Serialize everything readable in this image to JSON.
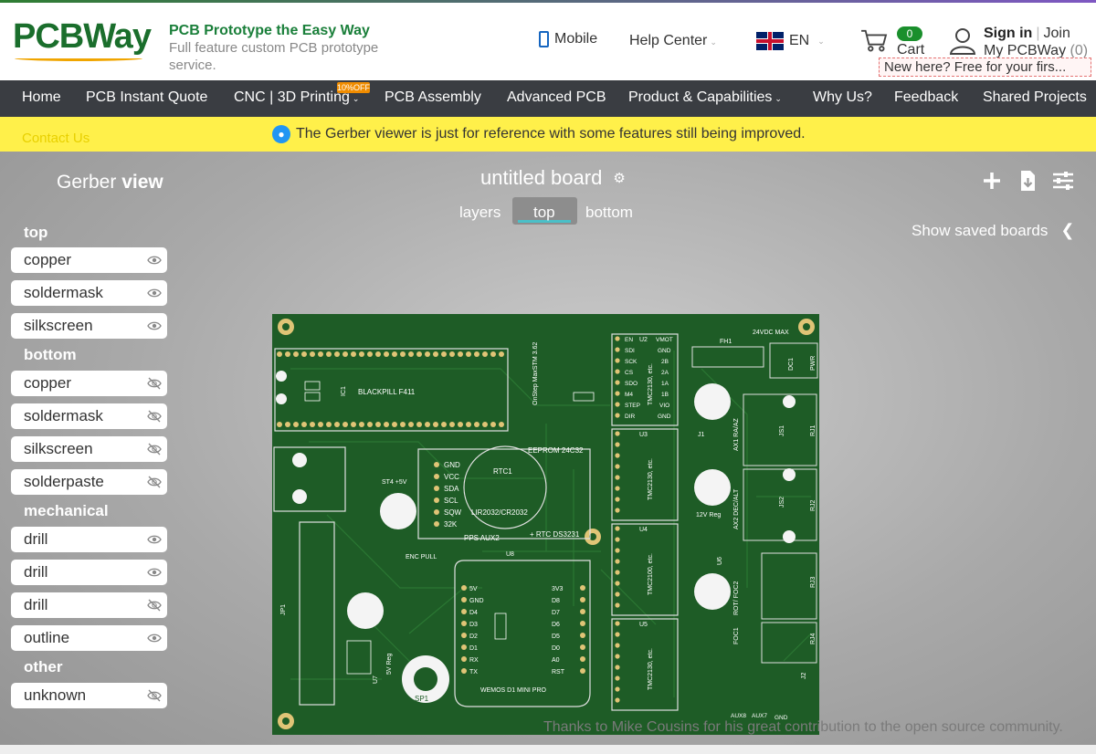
{
  "header": {
    "logo": "PCBWay",
    "tagline_title": "PCB Prototype the Easy Way",
    "tagline_sub": "Full feature custom PCB prototype service.",
    "mobile": "Mobile",
    "help_center": "Help Center",
    "language": "EN",
    "cart_count": "0",
    "cart_label": "Cart",
    "sign_in": "Sign in",
    "join": "Join",
    "my_pcbway": "My PCBWay",
    "my_pcbway_count": "(0)",
    "new_here": "New here? Free for your firs..."
  },
  "nav": {
    "items": [
      "Home",
      "PCB Instant Quote",
      "CNC | 3D Printing",
      "PCB Assembly",
      "Advanced PCB",
      "Product & Capabilities",
      "Why Us?",
      "Feedback",
      "Shared Projects"
    ],
    "badge": "10%OFF",
    "contact": "Contact Us"
  },
  "notice": "The Gerber viewer is just for reference with some features still being improved.",
  "viewer": {
    "title_light": "Gerber",
    "title_bold": "view",
    "board_name": "untitled board",
    "tabs": [
      "layers",
      "top",
      "bottom"
    ],
    "active_tab": "top",
    "show_saved": "Show saved boards",
    "credit": "Thanks to Mike Cousins for his great contribution to the open source community."
  },
  "layers": {
    "top_label": "top",
    "top": [
      {
        "name": "copper",
        "visible": true
      },
      {
        "name": "soldermask",
        "visible": true
      },
      {
        "name": "silkscreen",
        "visible": true
      }
    ],
    "bottom_label": "bottom",
    "bottom": [
      {
        "name": "copper",
        "visible": false
      },
      {
        "name": "soldermask",
        "visible": false
      },
      {
        "name": "silkscreen",
        "visible": false
      },
      {
        "name": "solderpaste",
        "visible": false
      }
    ],
    "mechanical_label": "mechanical",
    "mechanical": [
      {
        "name": "drill",
        "visible": true
      },
      {
        "name": "drill",
        "visible": true
      },
      {
        "name": "drill",
        "visible": false
      },
      {
        "name": "outline",
        "visible": true
      }
    ],
    "other_label": "other",
    "other": [
      {
        "name": "unknown",
        "visible": false
      }
    ]
  },
  "pcb_labels": {
    "blackpill": "BLACKPILL F411",
    "ic1": "IC1",
    "eeprom": "EEPROM 24C32",
    "rtc1": "RTC1",
    "battery": "LIR2032/CR2032",
    "rtc_ds": "+ RTC DS3231",
    "pps": "PPS AUX2",
    "u8": "U8",
    "wemos": "WEMOS D1 MINI PRO",
    "onstep": "OnStep MaxSTM 3.62",
    "enc_pull": "ENC PULL",
    "reg5v": "5V Reg",
    "reg12v": "12V Reg",
    "sp1": "SP1",
    "jp1": "JP1",
    "fh1": "FH1",
    "vmax": "24VDC MAX",
    "dc1": "DC1",
    "pwr": "PWR",
    "st4": "ST4 +5V",
    "u2": "U2",
    "u3": "U3",
    "u4": "U4",
    "u5": "U5",
    "tmc": "TMC2130, etc.",
    "tmc_u4": "TMC2100, etc.",
    "ax1": "AX1 RA/AZ",
    "ax2": "AX2 DEC/ALT",
    "rot": "ROT/ FOC2",
    "foc1": "FOC1",
    "rj1": "RJ1",
    "rj2": "RJ2",
    "rj3": "RJ3",
    "rj4": "RJ4",
    "js1": "JS1",
    "js2": "JS2",
    "aux8": "AUX8",
    "aux7": "AUX7",
    "gnd": "GND",
    "u7": "U7",
    "u6": "U6",
    "j1": "J1",
    "j2": "J2",
    "wemos_pins_left": [
      "5V",
      "GND",
      "D4",
      "D3",
      "D2",
      "D1",
      "RX",
      "TX"
    ],
    "wemos_pins_right": [
      "3V3",
      "D8",
      "D7",
      "D6",
      "D5",
      "D0",
      "A0",
      "RST"
    ],
    "rtc_pins": [
      "GND",
      "VCC",
      "SDA",
      "SCL",
      "SQW",
      "32K"
    ],
    "driver_pins_left": [
      "EN",
      "SDI",
      "SCK",
      "CS",
      "SDO",
      "M4",
      "STEP",
      "DIR"
    ],
    "driver_pins_right": [
      "VMOT",
      "GND",
      "2B",
      "2A",
      "1A",
      "1B",
      "VIO",
      "GND"
    ]
  }
}
